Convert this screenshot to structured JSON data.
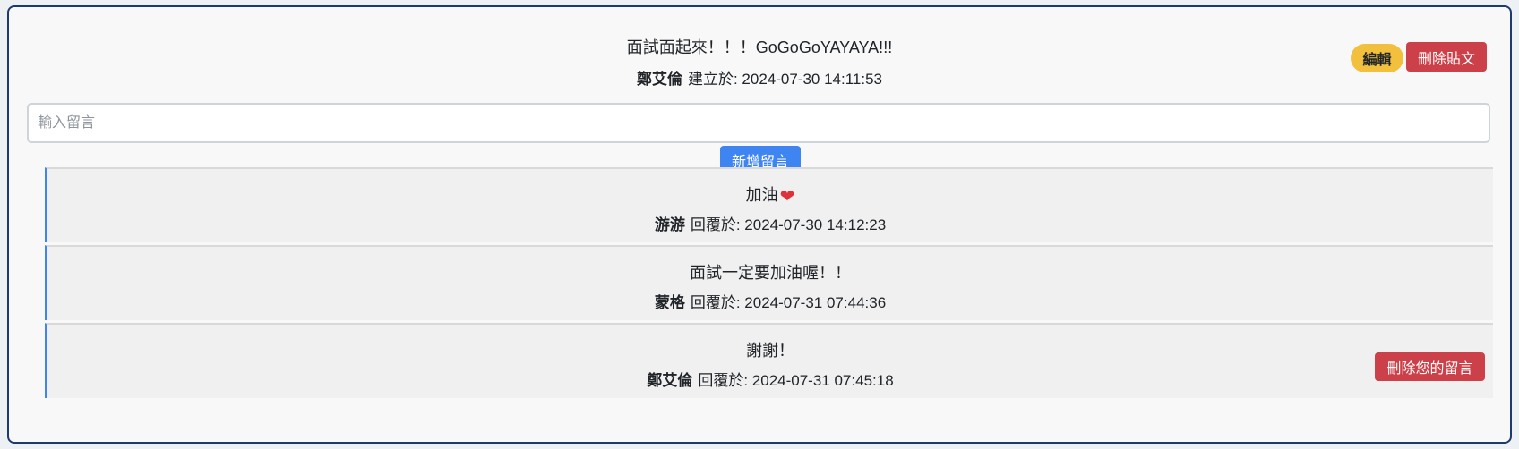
{
  "post": {
    "content": "面試面起來！！！GoGoGoYAYAYA!!!",
    "author": "鄭艾倫",
    "meta_label": "建立於:",
    "created_at": "2024-07-30 14:11:53",
    "edit_label": "編輯",
    "delete_label": "刪除貼文"
  },
  "comment_form": {
    "placeholder": "輸入留言",
    "value": "",
    "submit_label": "新增留言"
  },
  "replies": [
    {
      "content": "加油",
      "emoji": "❤",
      "author": "游游",
      "meta_label": "回覆於:",
      "replied_at": "2024-07-30 14:12:23"
    },
    {
      "content": "面試一定要加油喔！！",
      "author": "蒙格",
      "meta_label": "回覆於:",
      "replied_at": "2024-07-31 07:44:36"
    },
    {
      "content": "謝謝！",
      "author": "鄭艾倫",
      "meta_label": "回覆於:",
      "replied_at": "2024-07-31 07:45:18",
      "delete_label": "刪除您的留言"
    }
  ],
  "colors": {
    "accent_blue": "#3f85f2",
    "danger_red": "#cc4149",
    "edit_yellow": "#f2c03c",
    "card_border": "#1d3a6e",
    "heart_red": "#e0303a"
  },
  "icons": {
    "reply_1_emoji": "heart-icon"
  }
}
